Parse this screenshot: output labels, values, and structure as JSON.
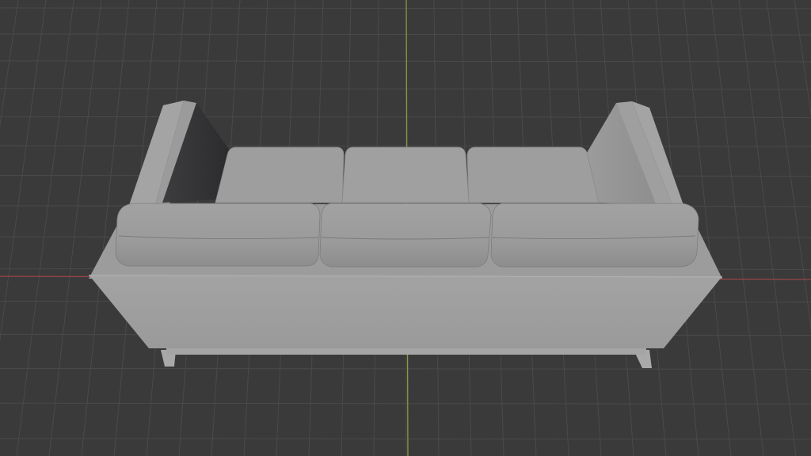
{
  "viewport": {
    "background_color": "#3a3a3a",
    "grid_line_color": "#4a4a4a",
    "x_axis_color": "#9c4446",
    "y_axis_color": "#8a9a3c"
  },
  "scene": {
    "object": "sofa",
    "shading": "solid",
    "material_color": "#9a9a9a",
    "back_cushions": 3,
    "seat_cushions": 3
  }
}
